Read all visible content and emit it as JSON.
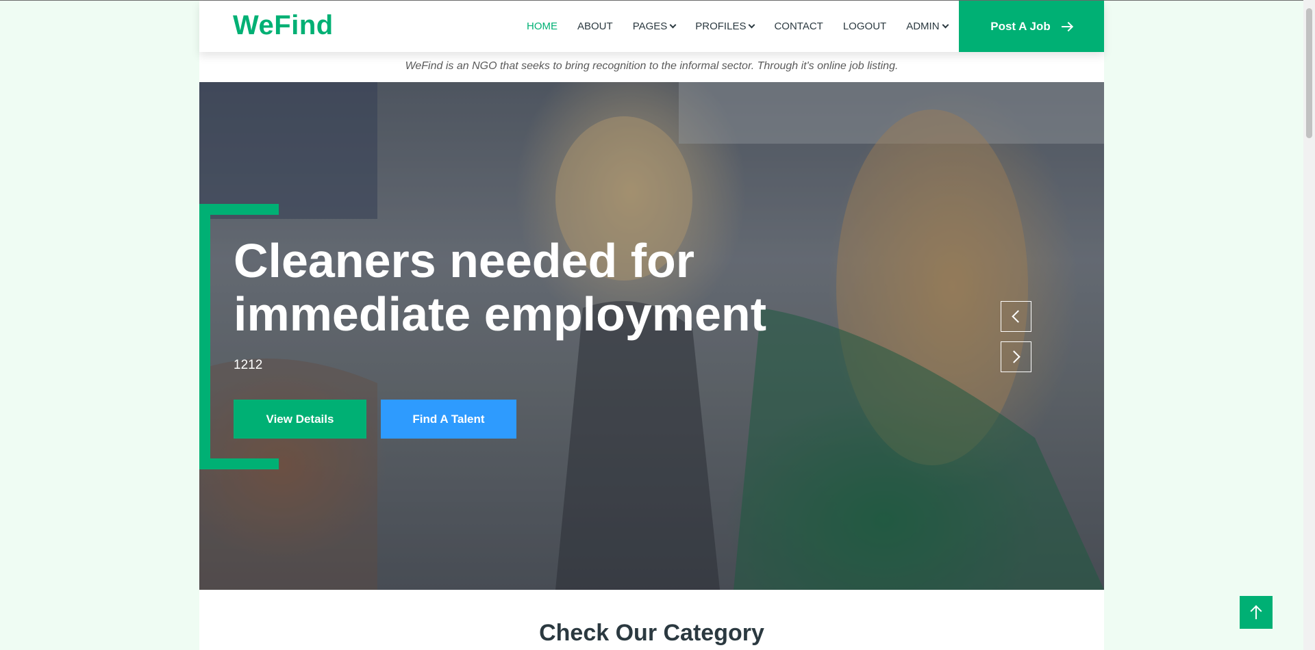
{
  "header": {
    "logo": "WeFind",
    "nav": [
      {
        "label": "HOME",
        "active": true,
        "dropdown": false
      },
      {
        "label": "ABOUT",
        "active": false,
        "dropdown": false
      },
      {
        "label": "PAGES",
        "active": false,
        "dropdown": true
      },
      {
        "label": "PROFILES",
        "active": false,
        "dropdown": true
      },
      {
        "label": "CONTACT",
        "active": false,
        "dropdown": false
      },
      {
        "label": "LOGOUT",
        "active": false,
        "dropdown": false
      },
      {
        "label": "ADMIN",
        "active": false,
        "dropdown": true
      }
    ],
    "post_job_label": "Post A Job"
  },
  "tagline": "WeFind is an NGO that seeks to bring recognition to the informal sector. Through it's online job listing.",
  "hero": {
    "title": "Cleaners needed for immediate employment",
    "subtitle": "1212",
    "view_details_label": "View Details",
    "find_talent_label": "Find A Talent"
  },
  "category": {
    "title": "Check Our Category"
  },
  "colors": {
    "accent": "#00b074",
    "blue": "#2e9bfe",
    "text_dark": "#2b3940",
    "page_bg": "#effcf3"
  },
  "icons": [
    "chevron-down-icon",
    "arrow-right-icon",
    "chevron-left-icon",
    "chevron-right-icon",
    "arrow-up-icon"
  ]
}
